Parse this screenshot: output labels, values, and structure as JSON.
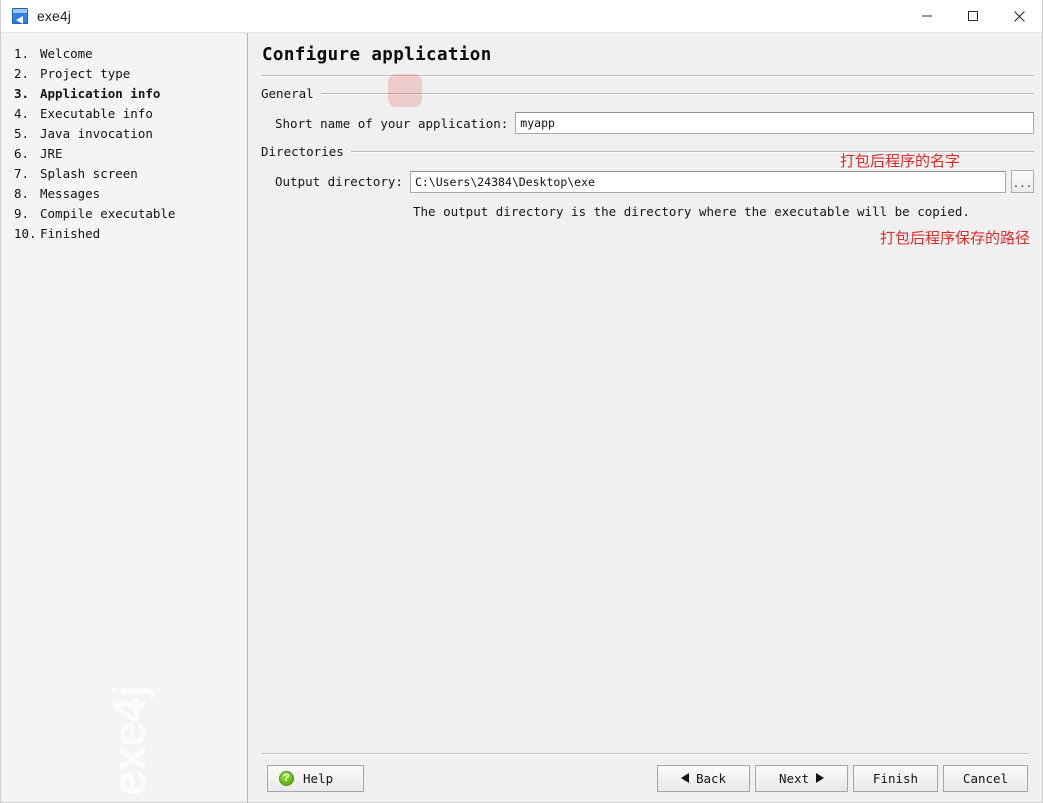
{
  "window": {
    "title": "exe4j",
    "icon": "exe4j-app-icon",
    "controls": {
      "minimize": "minimize-icon",
      "maximize": "maximize-icon",
      "close": "close-icon"
    }
  },
  "sidebar": {
    "watermark": "exe4j",
    "items": [
      {
        "num": "1.",
        "label": "Welcome",
        "active": false
      },
      {
        "num": "2.",
        "label": "Project type",
        "active": false
      },
      {
        "num": "3.",
        "label": "Application info",
        "active": true
      },
      {
        "num": "4.",
        "label": "Executable info",
        "active": false
      },
      {
        "num": "5.",
        "label": "Java invocation",
        "active": false
      },
      {
        "num": "6.",
        "label": "JRE",
        "active": false
      },
      {
        "num": "7.",
        "label": "Splash screen",
        "active": false
      },
      {
        "num": "8.",
        "label": "Messages",
        "active": false
      },
      {
        "num": "9.",
        "label": "Compile executable",
        "active": false
      },
      {
        "num": "10.",
        "label": "Finished",
        "active": false
      }
    ]
  },
  "main": {
    "page_title": "Configure application",
    "groups": {
      "general": {
        "title": "General",
        "short_name_label": "Short name of your application:",
        "short_name_value": "myapp",
        "short_name_placeholder": "myapp",
        "annotation": "打包后程序的名字"
      },
      "directories": {
        "title": "Directories",
        "output_dir_label": "Output directory:",
        "output_dir_value": "C:\\Users\\24384\\Desktop\\exe",
        "output_dir_placeholder": "C:\\Users\\24384\\Desktop\\exe",
        "browse_label": "...",
        "annotation": "打包后程序保存的路径",
        "hint": "The output directory is the directory where the executable will be copied."
      }
    }
  },
  "buttonbar": {
    "help_label": "Help",
    "help_icon_glyph": "?",
    "back_label": "Back",
    "next_label": "Next",
    "finish_label": "Finish",
    "cancel_label": "Cancel"
  },
  "colors": {
    "annotation_red": "#e02a2a",
    "help_green": "#6cbf20",
    "accent_blue": "#2f80e0",
    "panel_gray": "#f0f0f0",
    "sidebar_gray": "#f4f4f4"
  }
}
